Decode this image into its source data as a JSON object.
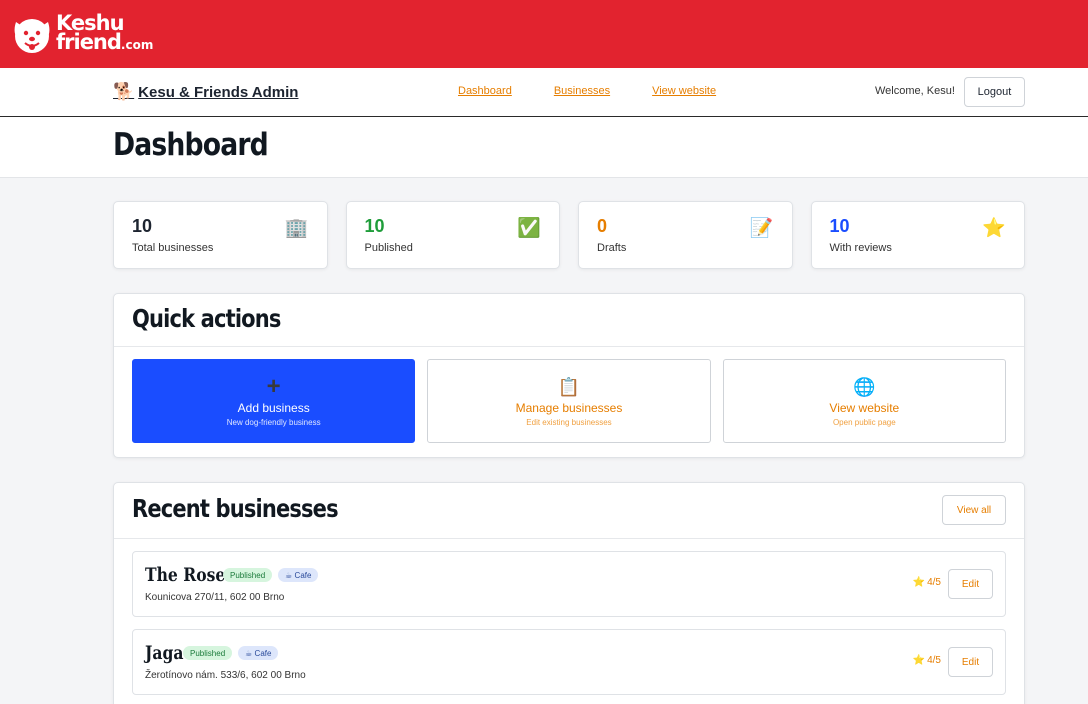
{
  "site_logo": {
    "line1": "Keshu",
    "line2": "friend",
    "suffix": ".com"
  },
  "navbar": {
    "brand": "Kesu & Friends Admin",
    "brand_icon": "🐕",
    "links": [
      "Dashboard",
      "Businesses",
      "View website"
    ],
    "welcome": "Welcome, Kesu!",
    "logout_label": "Logout"
  },
  "page": {
    "title": "Dashboard"
  },
  "stats": [
    {
      "value": "10",
      "label": "Total businesses",
      "icon": "🏢",
      "color": "#1d2430"
    },
    {
      "value": "10",
      "label": "Published",
      "icon": "✅",
      "color": "#1f9d3a"
    },
    {
      "value": "0",
      "label": "Drafts",
      "icon": "📝",
      "color": "#e67e00"
    },
    {
      "value": "10",
      "label": "With reviews",
      "icon": "⭐",
      "color": "#1a4dff"
    }
  ],
  "quick_actions": {
    "title": "Quick actions",
    "items": [
      {
        "icon": "+",
        "label": "Add business",
        "sub": "New dog-friendly business"
      },
      {
        "icon": "📋",
        "label": "Manage businesses",
        "sub": "Edit existing businesses"
      },
      {
        "icon": "🌐",
        "label": "View website",
        "sub": "Open public page"
      }
    ]
  },
  "recent": {
    "title": "Recent businesses",
    "view_all_label": "View all",
    "items": [
      {
        "name": "The Roses",
        "status": "Published",
        "category": "☕ Cafe",
        "address": "Kounicova 270/11, 602 00 Brno",
        "rating": "4/5",
        "edit_label": "Edit"
      },
      {
        "name": "Jaga",
        "status": "Published",
        "category": "☕ Cafe",
        "address": "Žerotínovo nám. 533/6, 602 00 Brno",
        "rating": "4/5",
        "edit_label": "Edit"
      }
    ]
  },
  "colors": {
    "topbar": "#e2232f",
    "accent": "#e67e00",
    "primary": "#1a4dff"
  }
}
